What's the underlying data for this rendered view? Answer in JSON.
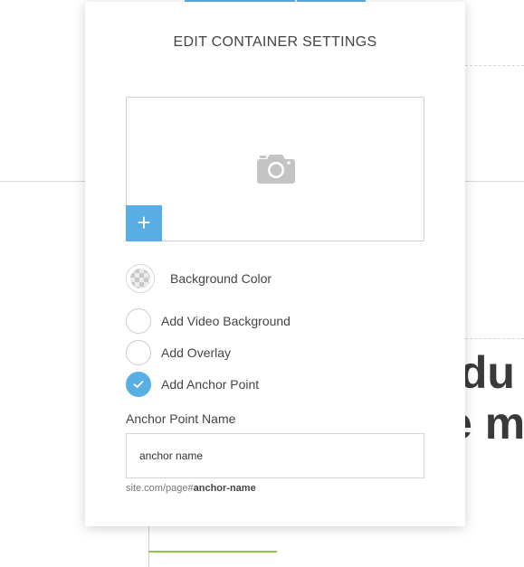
{
  "background": {
    "heading_line1": "idu",
    "heading_line2": "e m"
  },
  "modal": {
    "title": "EDIT CONTAINER SETTINGS",
    "image_area": {
      "add_button_label": "+",
      "camera_icon": "camera-icon"
    },
    "background_color": {
      "label": "Background Color"
    },
    "options": [
      {
        "label": "Add Video Background",
        "checked": false
      },
      {
        "label": "Add Overlay",
        "checked": false
      },
      {
        "label": "Add Anchor Point",
        "checked": true
      }
    ],
    "anchor": {
      "field_label": "Anchor Point Name",
      "value": "anchor name",
      "url_prefix": "site.com/page#",
      "url_slug": "anchor-name"
    }
  },
  "colors": {
    "accent": "#5aaee6",
    "green_line": "#8cc63f",
    "text": "#444444"
  }
}
